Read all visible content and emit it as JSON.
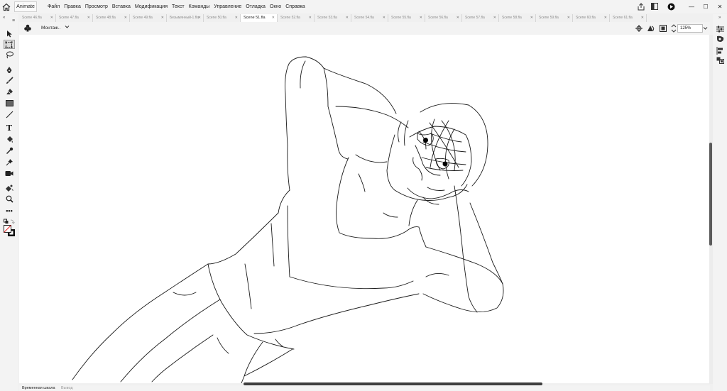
{
  "app": {
    "name": "Animate"
  },
  "menu": [
    "Файл",
    "Правка",
    "Просмотр",
    "Вставка",
    "Модификация",
    "Текст",
    "Команды",
    "Управление",
    "Отладка",
    "Окно",
    "Справка"
  ],
  "tabs": [
    {
      "label": "Scene 46.fla",
      "active": false
    },
    {
      "label": "Scene 47.fla",
      "active": false
    },
    {
      "label": "Scene 48.fla",
      "active": false
    },
    {
      "label": "Scene 49.fla",
      "active": false
    },
    {
      "label": "Безымянный-1.fla",
      "active": false
    },
    {
      "label": "Scene 50.fla",
      "active": false
    },
    {
      "label": "Scene 51.fla",
      "active": true
    },
    {
      "label": "Scene 52.fla",
      "active": false
    },
    {
      "label": "Scene 53.fla",
      "active": false
    },
    {
      "label": "Scene 54.fla",
      "active": false
    },
    {
      "label": "Scene 55.fla",
      "active": false
    },
    {
      "label": "Scene 56.fla",
      "active": false
    },
    {
      "label": "Scene 57.fla",
      "active": false
    },
    {
      "label": "Scene 58.fla",
      "active": false
    },
    {
      "label": "Scene 59.fla",
      "active": false
    },
    {
      "label": "Scene 60.fla",
      "active": false
    },
    {
      "label": "Scene 61.fla",
      "active": false
    }
  ],
  "scene": {
    "name": "Монтаж..",
    "zoom": "125%"
  },
  "bottom_tabs": [
    "Временная шкала",
    "Вывод"
  ],
  "tools": [
    "selection-tool",
    "free-transform-tool",
    "lasso-tool",
    "pen-tool",
    "brush-tool",
    "eraser-tool",
    "rectangle-tool",
    "line-tool",
    "text-tool",
    "paint-bucket-tool",
    "eyedropper-tool",
    "pin-tool",
    "camera-tool",
    "asset-warp-tool",
    "zoom-tool",
    "more-tools"
  ],
  "colors": {
    "accent": "#1473e6",
    "stage": "#ffffff",
    "chrome": "#f3f3f3"
  }
}
